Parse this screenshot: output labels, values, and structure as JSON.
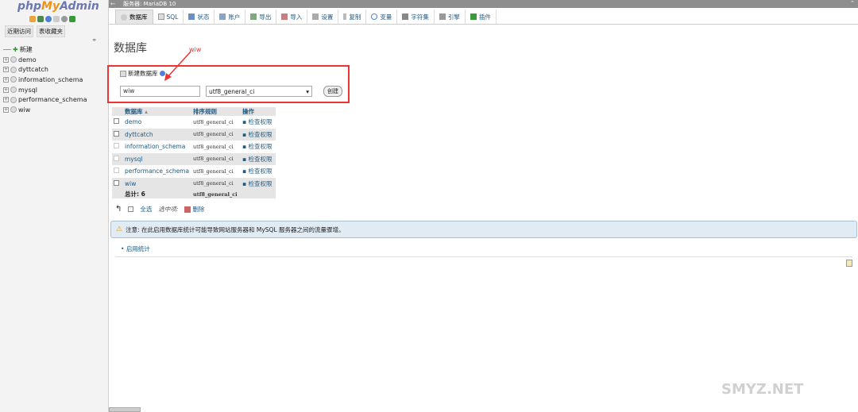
{
  "logo": {
    "php": "php",
    "my": "My",
    "admin": "Admin"
  },
  "nav": {
    "tabs": [
      "近期访问",
      "表收藏夹"
    ]
  },
  "tree": {
    "new_label": "新建",
    "items": [
      "demo",
      "dyttcatch",
      "information_schema",
      "mysql",
      "performance_schema",
      "wiw"
    ]
  },
  "topbar": {
    "title": "服务器: MariaDB 10"
  },
  "menu": {
    "tabs": [
      {
        "label": "数据库",
        "icon": "database-icon"
      },
      {
        "label": "SQL",
        "icon": "sql-icon"
      },
      {
        "label": "状态",
        "icon": "status-icon"
      },
      {
        "label": "账户",
        "icon": "users-icon"
      },
      {
        "label": "导出",
        "icon": "export-icon"
      },
      {
        "label": "导入",
        "icon": "import-icon"
      },
      {
        "label": "设置",
        "icon": "settings-icon"
      },
      {
        "label": "复制",
        "icon": "replication-icon"
      },
      {
        "label": "变量",
        "icon": "variables-icon"
      },
      {
        "label": "字符集",
        "icon": "charset-icon"
      },
      {
        "label": "引擎",
        "icon": "engine-icon"
      },
      {
        "label": "插件",
        "icon": "plugin-icon"
      }
    ]
  },
  "main": {
    "title": "数据库",
    "annotation": "wiw",
    "create": {
      "legend": "新建数据库",
      "name_value": "wiw",
      "collation_value": "utf8_general_ci",
      "button_label": "创建"
    },
    "table": {
      "headers": [
        "数据库",
        "排序规则",
        "操作"
      ],
      "rows": [
        {
          "name": "demo",
          "collation": "utf8_general_ci",
          "action": "检查权限"
        },
        {
          "name": "dyttcatch",
          "collation": "utf8_general_ci",
          "action": "检查权限"
        },
        {
          "name": "information_schema",
          "collation": "utf8_general_ci",
          "action": "检查权限"
        },
        {
          "name": "mysql",
          "collation": "utf8_general_ci",
          "action": "检查权限"
        },
        {
          "name": "performance_schema",
          "collation": "utf8_general_ci",
          "action": "检查权限"
        },
        {
          "name": "wiw",
          "collation": "utf8_general_ci",
          "action": "检查权限"
        }
      ],
      "total_label": "总计: 6",
      "total_collation": "utf8_general_ci"
    },
    "bulk": {
      "select_all": "全选",
      "with_selected": "选中项:",
      "delete": "删除"
    },
    "notice": "注意: 在此启用数据库统计可能导致网站服务器和 MySQL 服务器之间的流量骤增。",
    "enable_stats": "启用统计"
  },
  "watermark": "SMYZ.NET",
  "colors": {
    "accent": "#235a81",
    "annotation": "#ee3333",
    "notice_bg": "#e0ebf4"
  }
}
